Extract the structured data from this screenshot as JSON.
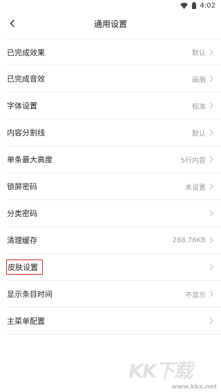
{
  "status_bar": {
    "time": "4:02"
  },
  "header": {
    "title": "通用设置"
  },
  "settings": [
    {
      "label": "已完成效果",
      "value": "默认"
    },
    {
      "label": "已完成音效",
      "value": "画眉"
    },
    {
      "label": "字体设置",
      "value": "标准"
    },
    {
      "label": "内容分割线",
      "value": "默认"
    },
    {
      "label": "单条最大高度",
      "value": "5行内容"
    },
    {
      "label": "锁屏密码",
      "value": "未设置"
    },
    {
      "label": "分类密码",
      "value": ""
    },
    {
      "label": "清理缓存",
      "value": "288.76KB"
    },
    {
      "label": "皮肤设置",
      "value": ""
    },
    {
      "label": "显示条目时间",
      "value": "不显示"
    },
    {
      "label": "主菜单配置",
      "value": ""
    }
  ],
  "watermark": {
    "logo": "KK下载",
    "url": "www.kkx.net"
  },
  "colors": {
    "highlight": "#e02020",
    "value_text": "#9a9a9a",
    "divider": "#ececec"
  }
}
